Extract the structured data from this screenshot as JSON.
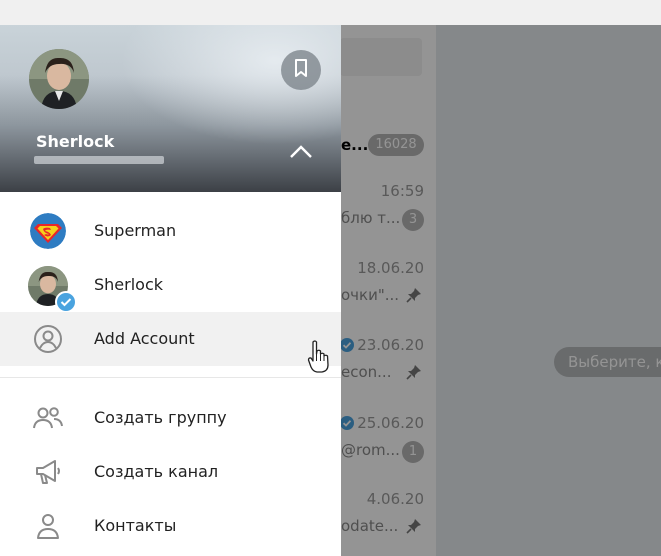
{
  "profile": {
    "name": "Sherlock"
  },
  "accounts": [
    {
      "label": "Superman"
    },
    {
      "label": "Sherlock"
    },
    {
      "label": "Add Account"
    }
  ],
  "menu": [
    {
      "label": "Создать группу",
      "icon": "group-icon"
    },
    {
      "label": "Создать канал",
      "icon": "megaphone-icon"
    },
    {
      "label": "Контакты",
      "icon": "contact-icon"
    }
  ],
  "background_chats": [
    {
      "preview": "е...",
      "badge": "16028"
    },
    {
      "time": "16:59",
      "preview": "блю т...",
      "badge": "3"
    },
    {
      "time": "18.06.20",
      "preview": "очки\"..."
    },
    {
      "time": "23.06.20",
      "preview": "econ..."
    },
    {
      "time": "25.06.20",
      "preview": "@rom...",
      "badge": "1"
    },
    {
      "time": "4.06.20",
      "preview": "odate..."
    }
  ],
  "empty_state": "Выберите, к",
  "colors": {
    "accent": "#4aa3df",
    "hover": "#f1f1f1",
    "badge": "#b5b5b5"
  }
}
